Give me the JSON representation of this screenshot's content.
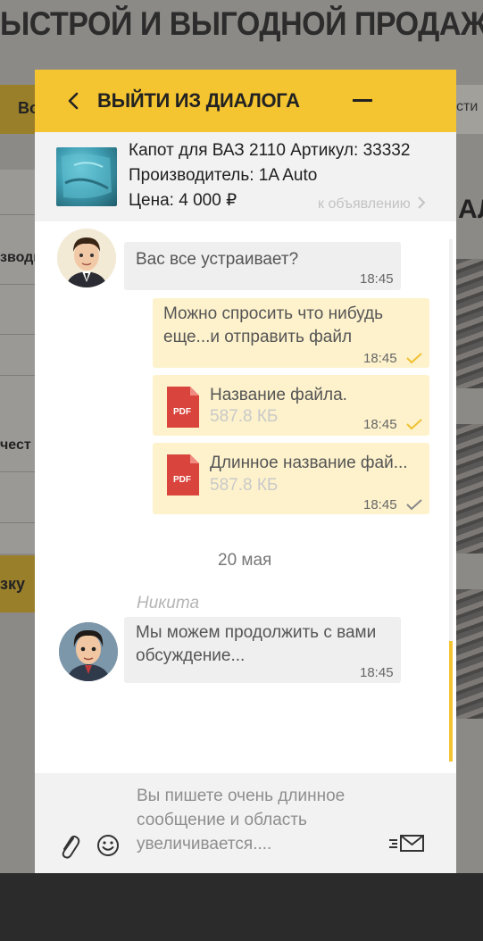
{
  "background": {
    "headline": "ЫСТРОЙ И ВЫГОДНОЙ ПРОДАЖ",
    "left_tab": "Во",
    "right_tab": "сти",
    "left_items": [
      "зводи",
      "чест"
    ],
    "left_button": "зку",
    "right_title": "АЛ"
  },
  "header": {
    "back_icon": "chevron-left-icon",
    "title": "ВЫЙТИ ИЗ ДИАЛОГА",
    "minimize_icon": "minus-icon"
  },
  "product": {
    "name_line": "Капот для ВАЗ 2110  Артикул: 33332",
    "manufacturer_line": "Производитель: 1A Auto",
    "price_line": "Цена: 4 000 ₽",
    "link": "к объявлению"
  },
  "messages": [
    {
      "direction": "in",
      "text": "Вас все устраивает?",
      "time": "18:45"
    },
    {
      "direction": "out",
      "lines": [
        "Можно спросить что нибудь",
        "еще...и отправить файл"
      ],
      "time": "18:45",
      "status": "read"
    },
    {
      "direction": "out",
      "type": "file",
      "file_name": "Название файла.",
      "file_size": "587.8 КБ",
      "time": "18:45",
      "status": "read",
      "icon": "pdf-icon",
      "icon_label": "PDF"
    },
    {
      "direction": "out",
      "type": "file",
      "file_name": "Длинное название фай...",
      "file_size": "587.8 КБ",
      "time": "18:45",
      "status": "delivered",
      "icon": "pdf-icon",
      "icon_label": "PDF"
    }
  ],
  "date_separator": "20 мая",
  "second_sender": "Никита",
  "second_message": {
    "lines": [
      "Мы можем продолжить с вами",
      "обсуждение..."
    ],
    "time": "18:45"
  },
  "composer": {
    "lines": [
      "Вы пишете очень длинное",
      "сообщение и область",
      "увеличивается...."
    ],
    "attach_icon": "paperclip-icon",
    "emoji_icon": "smiley-icon",
    "send_icon": "send-icon"
  },
  "colors": {
    "accent": "#f4c431",
    "outgoing_bubble": "#fdf2cc",
    "incoming_bubble": "#efefef",
    "pdf_red": "#d9453c",
    "check_read": "#f0c030",
    "check_delivered": "#888888"
  }
}
